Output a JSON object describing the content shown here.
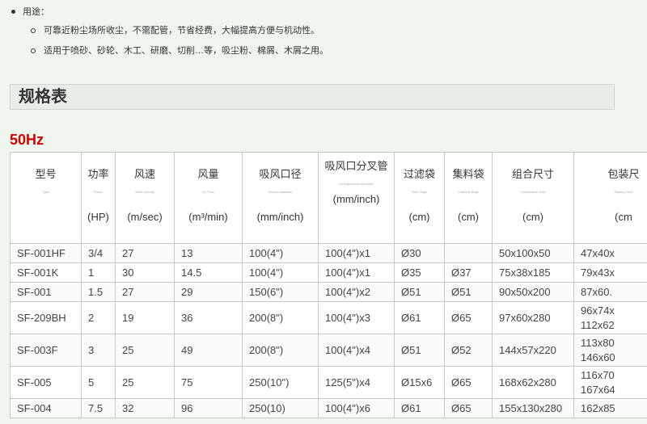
{
  "usage": {
    "title": "用途：",
    "items": [
      "可靠近粉尘场所收尘，不需配管，节省经费，大幅提高方便与机动性。",
      "适用于喷砂、砂轮、木工、研磨、切削…等，吸尘粉、棉屑、木屑之用。"
    ]
  },
  "spec_header": "规格表",
  "frequency": "50Hz",
  "table": {
    "headers": [
      {
        "main": "型号",
        "sub": "Type",
        "unit": ""
      },
      {
        "main": "功率",
        "sub": "Power",
        "unit": "(HP)"
      },
      {
        "main": "风速",
        "sub": "Wind velocity",
        "unit": "(m/sec)"
      },
      {
        "main": "风量",
        "sub": "Air Flow",
        "unit": "(m³/min)"
      },
      {
        "main": "吸风口径",
        "sub": "Suction diameter",
        "unit": "(mm/inch)"
      },
      {
        "main": "吸风口分叉管",
        "sub": "Divergemence diameter",
        "unit": "(mm/inch)"
      },
      {
        "main": "过滤袋",
        "sub": "Filter Bags",
        "unit": "(cm)"
      },
      {
        "main": "集料袋",
        "sub": "Collector Bags",
        "unit": "(cm)"
      },
      {
        "main": "组合尺寸",
        "sub": "Combination Size",
        "unit": "(cm)"
      },
      {
        "main": "包装尺",
        "sub": "Packing Size",
        "unit": "(cm"
      }
    ],
    "rows": [
      [
        "SF-001HF",
        "3/4",
        "27",
        "13",
        "100(4\")",
        "100(4\")x1",
        "Ø30",
        "",
        "50x100x50",
        "47x40x"
      ],
      [
        "SF-001K",
        "1",
        "30",
        "14.5",
        "100(4\")",
        "100(4\")x1",
        "Ø35",
        "Ø37",
        "75x38x185",
        "79x43x"
      ],
      [
        "SF-001",
        "1.5",
        "27",
        "29",
        "150(6\")",
        "100(4\")x2",
        "Ø51",
        "Ø51",
        "90x50x200",
        "87x60."
      ],
      [
        "SF-209BH",
        "2",
        "19",
        "36",
        "200(8\")",
        "100(4\")x3",
        "Ø61",
        "Ø65",
        "97x60x280",
        "96x74x\n112x62"
      ],
      [
        "SF-003F",
        "3",
        "25",
        "49",
        "200(8\")",
        "100(4\")x4",
        "Ø51",
        "Ø52",
        "144x57x220",
        "113x80\n146x60"
      ],
      [
        "SF-005",
        "5",
        "25",
        "75",
        "250(10\")",
        "125(5\")x4",
        "Ø15x6",
        "Ø65",
        "168x62x280",
        "116x70\n167x64"
      ],
      [
        "SF-004",
        "7.5",
        "32",
        "96",
        "250(10)",
        "100(4\")x6",
        "Ø61",
        "Ø65",
        "155x130x280",
        "162x85"
      ]
    ]
  }
}
